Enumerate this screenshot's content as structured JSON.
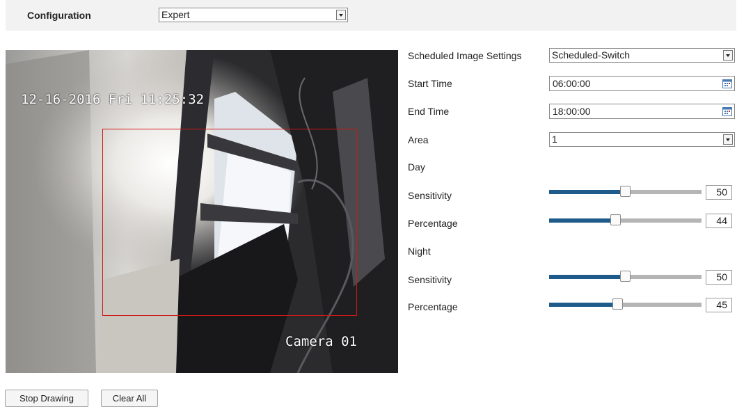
{
  "header": {
    "configuration_label": "Configuration",
    "mode_select_value": "Expert"
  },
  "video": {
    "timestamp": "12-16-2016 Fri 11:25:32",
    "camera_name": "Camera 01",
    "roi_color": "#d01818"
  },
  "settings": {
    "schedule_label": "Scheduled Image Settings",
    "schedule_value": "Scheduled-Switch",
    "start_time_label": "Start Time",
    "start_time_value": "06:00:00",
    "end_time_label": "End Time",
    "end_time_value": "18:00:00",
    "area_label": "Area",
    "area_value": "1",
    "day_label": "Day",
    "night_label": "Night",
    "day_sensitivity_label": "Sensitivity",
    "day_sensitivity_value": "50",
    "day_percentage_label": "Percentage",
    "day_percentage_value": "44",
    "night_sensitivity_label": "Sensitivity",
    "night_sensitivity_value": "50",
    "night_percentage_label": "Percentage",
    "night_percentage_value": "45"
  },
  "sliders": [
    {
      "name": "day-sensitivity",
      "level": 0.5
    },
    {
      "name": "day-percentage",
      "level": 0.44
    },
    {
      "name": "night-sensitivity",
      "level": 0.5
    },
    {
      "name": "night-percentage",
      "level": 0.45
    }
  ],
  "colors": {
    "slider_fill": "#1e5a8a",
    "slider_track": "#b5b5b5",
    "header_bg": "#f2f2f2"
  },
  "buttons": {
    "stop_drawing": "Stop Drawing",
    "clear_all": "Clear All"
  }
}
